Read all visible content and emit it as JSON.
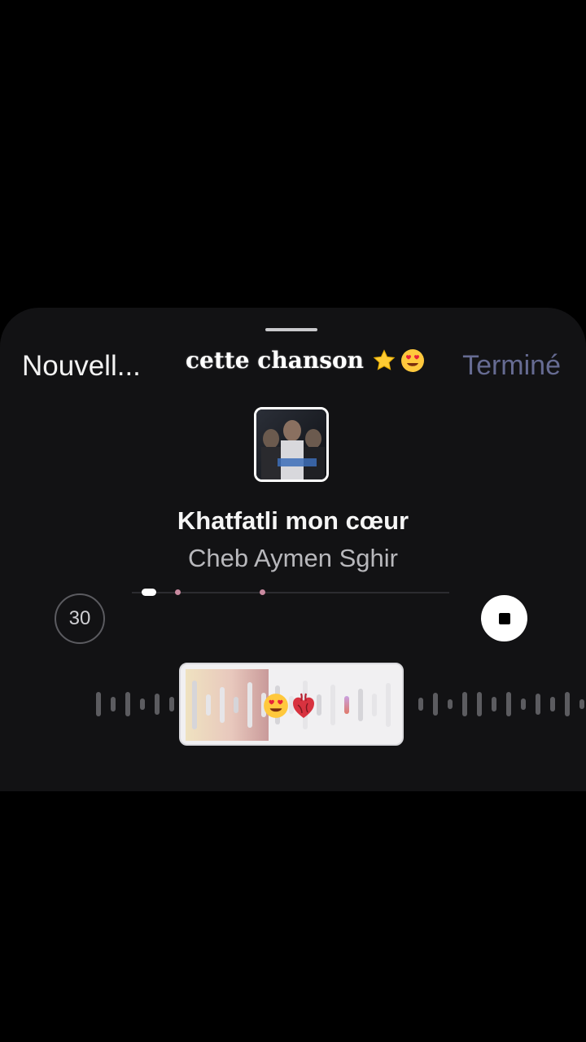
{
  "header": {
    "left_title": "Nouvell...",
    "caption_text": "cette chanson",
    "caption_emojis": [
      "star-emoji",
      "heart-eyes-emoji"
    ],
    "done_label": "Terminé"
  },
  "track": {
    "title": "Khatfatli mon cœur",
    "artist": "Cheb Aymen Sghir"
  },
  "controls": {
    "duration_label": "30"
  },
  "colors": {
    "sheet_bg": "#121214",
    "done": "#666b92",
    "accent_dot": "#c98aa0"
  }
}
